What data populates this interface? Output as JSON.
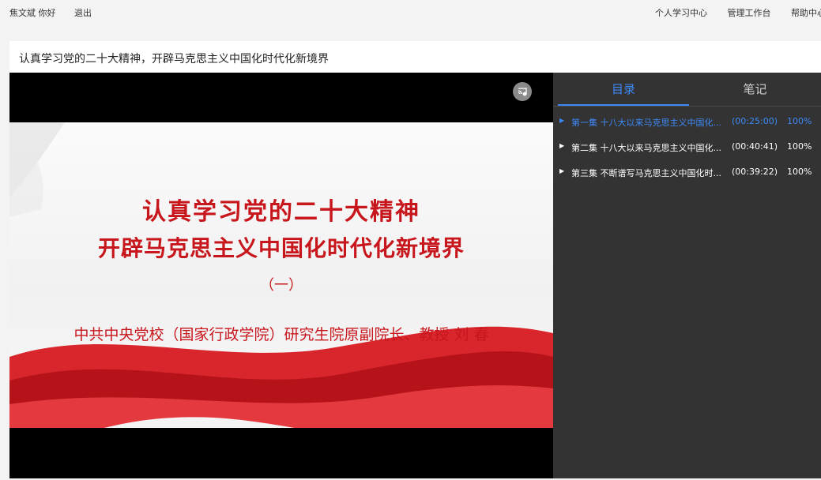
{
  "topbar": {
    "user_greeting": "焦文斌 你好",
    "logout": "退出",
    "links": [
      "个人学习中心",
      "管理工作台",
      "帮助中心"
    ]
  },
  "course": {
    "title": "认真学习党的二十大精神，开辟马克思主义中国化时代化新境界"
  },
  "slide": {
    "line1": "认真学习党的二十大精神",
    "line2": "开辟马克思主义中国化时代化新境界",
    "line3": "（一）",
    "line4": "中共中央党校（国家行政学院）研究生院原副院长、教授   刘 春"
  },
  "panel": {
    "tabs": [
      "目录",
      "笔记"
    ],
    "active_tab": "目录",
    "episodes": [
      {
        "name": "第一集 十八大以来马克思主义中国化...",
        "duration": "(00:25:00)",
        "progress": "100%",
        "active": true
      },
      {
        "name": "第二集 十八大以来马克思主义中国化...",
        "duration": "(00:40:41)",
        "progress": "100%",
        "active": false
      },
      {
        "name": "第三集 不断谱写马克思主义中国化时...",
        "duration": "(00:39:22)",
        "progress": "100%",
        "active": false
      }
    ]
  },
  "colors": {
    "accent": "#3d8af7",
    "panel_bg": "#333333",
    "slide_red": "#c8161d"
  },
  "icons": {
    "cast": "cast-icon",
    "episode_arrow": "play-triangle-icon"
  }
}
